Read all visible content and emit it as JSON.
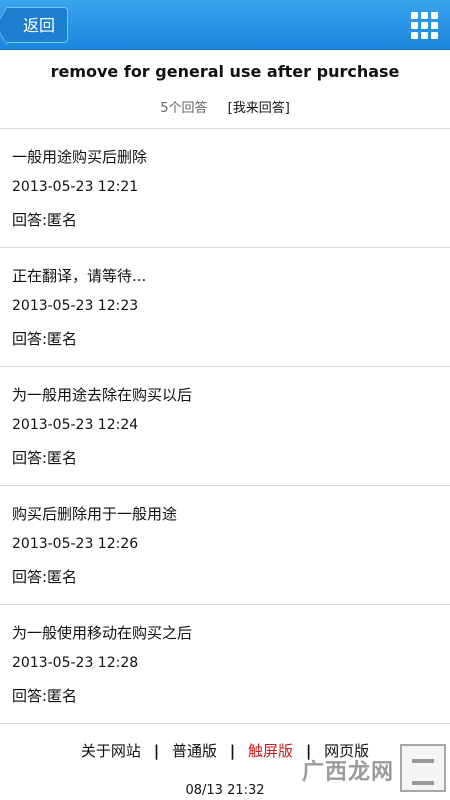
{
  "header": {
    "back_label": "返回",
    "menu_icon": "grid-icon"
  },
  "question": {
    "title": "remove for general use after purchase",
    "answer_count": "5个回答",
    "answer_link": "[我来回答]"
  },
  "answers": [
    {
      "text": "一般用途购买后删除",
      "time": "2013-05-23 12:21",
      "author": "回答:匿名"
    },
    {
      "text": "正在翻译，请等待...",
      "time": "2013-05-23 12:23",
      "author": "回答:匿名"
    },
    {
      "text": "为一般用途去除在购买以后",
      "time": "2013-05-23 12:24",
      "author": "回答:匿名"
    },
    {
      "text": "购买后删除用于一般用途",
      "time": "2013-05-23 12:26",
      "author": "回答:匿名"
    },
    {
      "text": "为一般使用移动在购买之后",
      "time": "2013-05-23 12:28",
      "author": "回答:匿名"
    }
  ],
  "footer": {
    "links": [
      "关于网站",
      "普通版",
      "触屏版",
      "网页版"
    ],
    "separator": "|",
    "time": "08/13 21:32"
  },
  "watermark": {
    "text": "广西龙网"
  },
  "colors": {
    "header_blue": "#1b86dd",
    "active_link": "#c81e1e"
  }
}
